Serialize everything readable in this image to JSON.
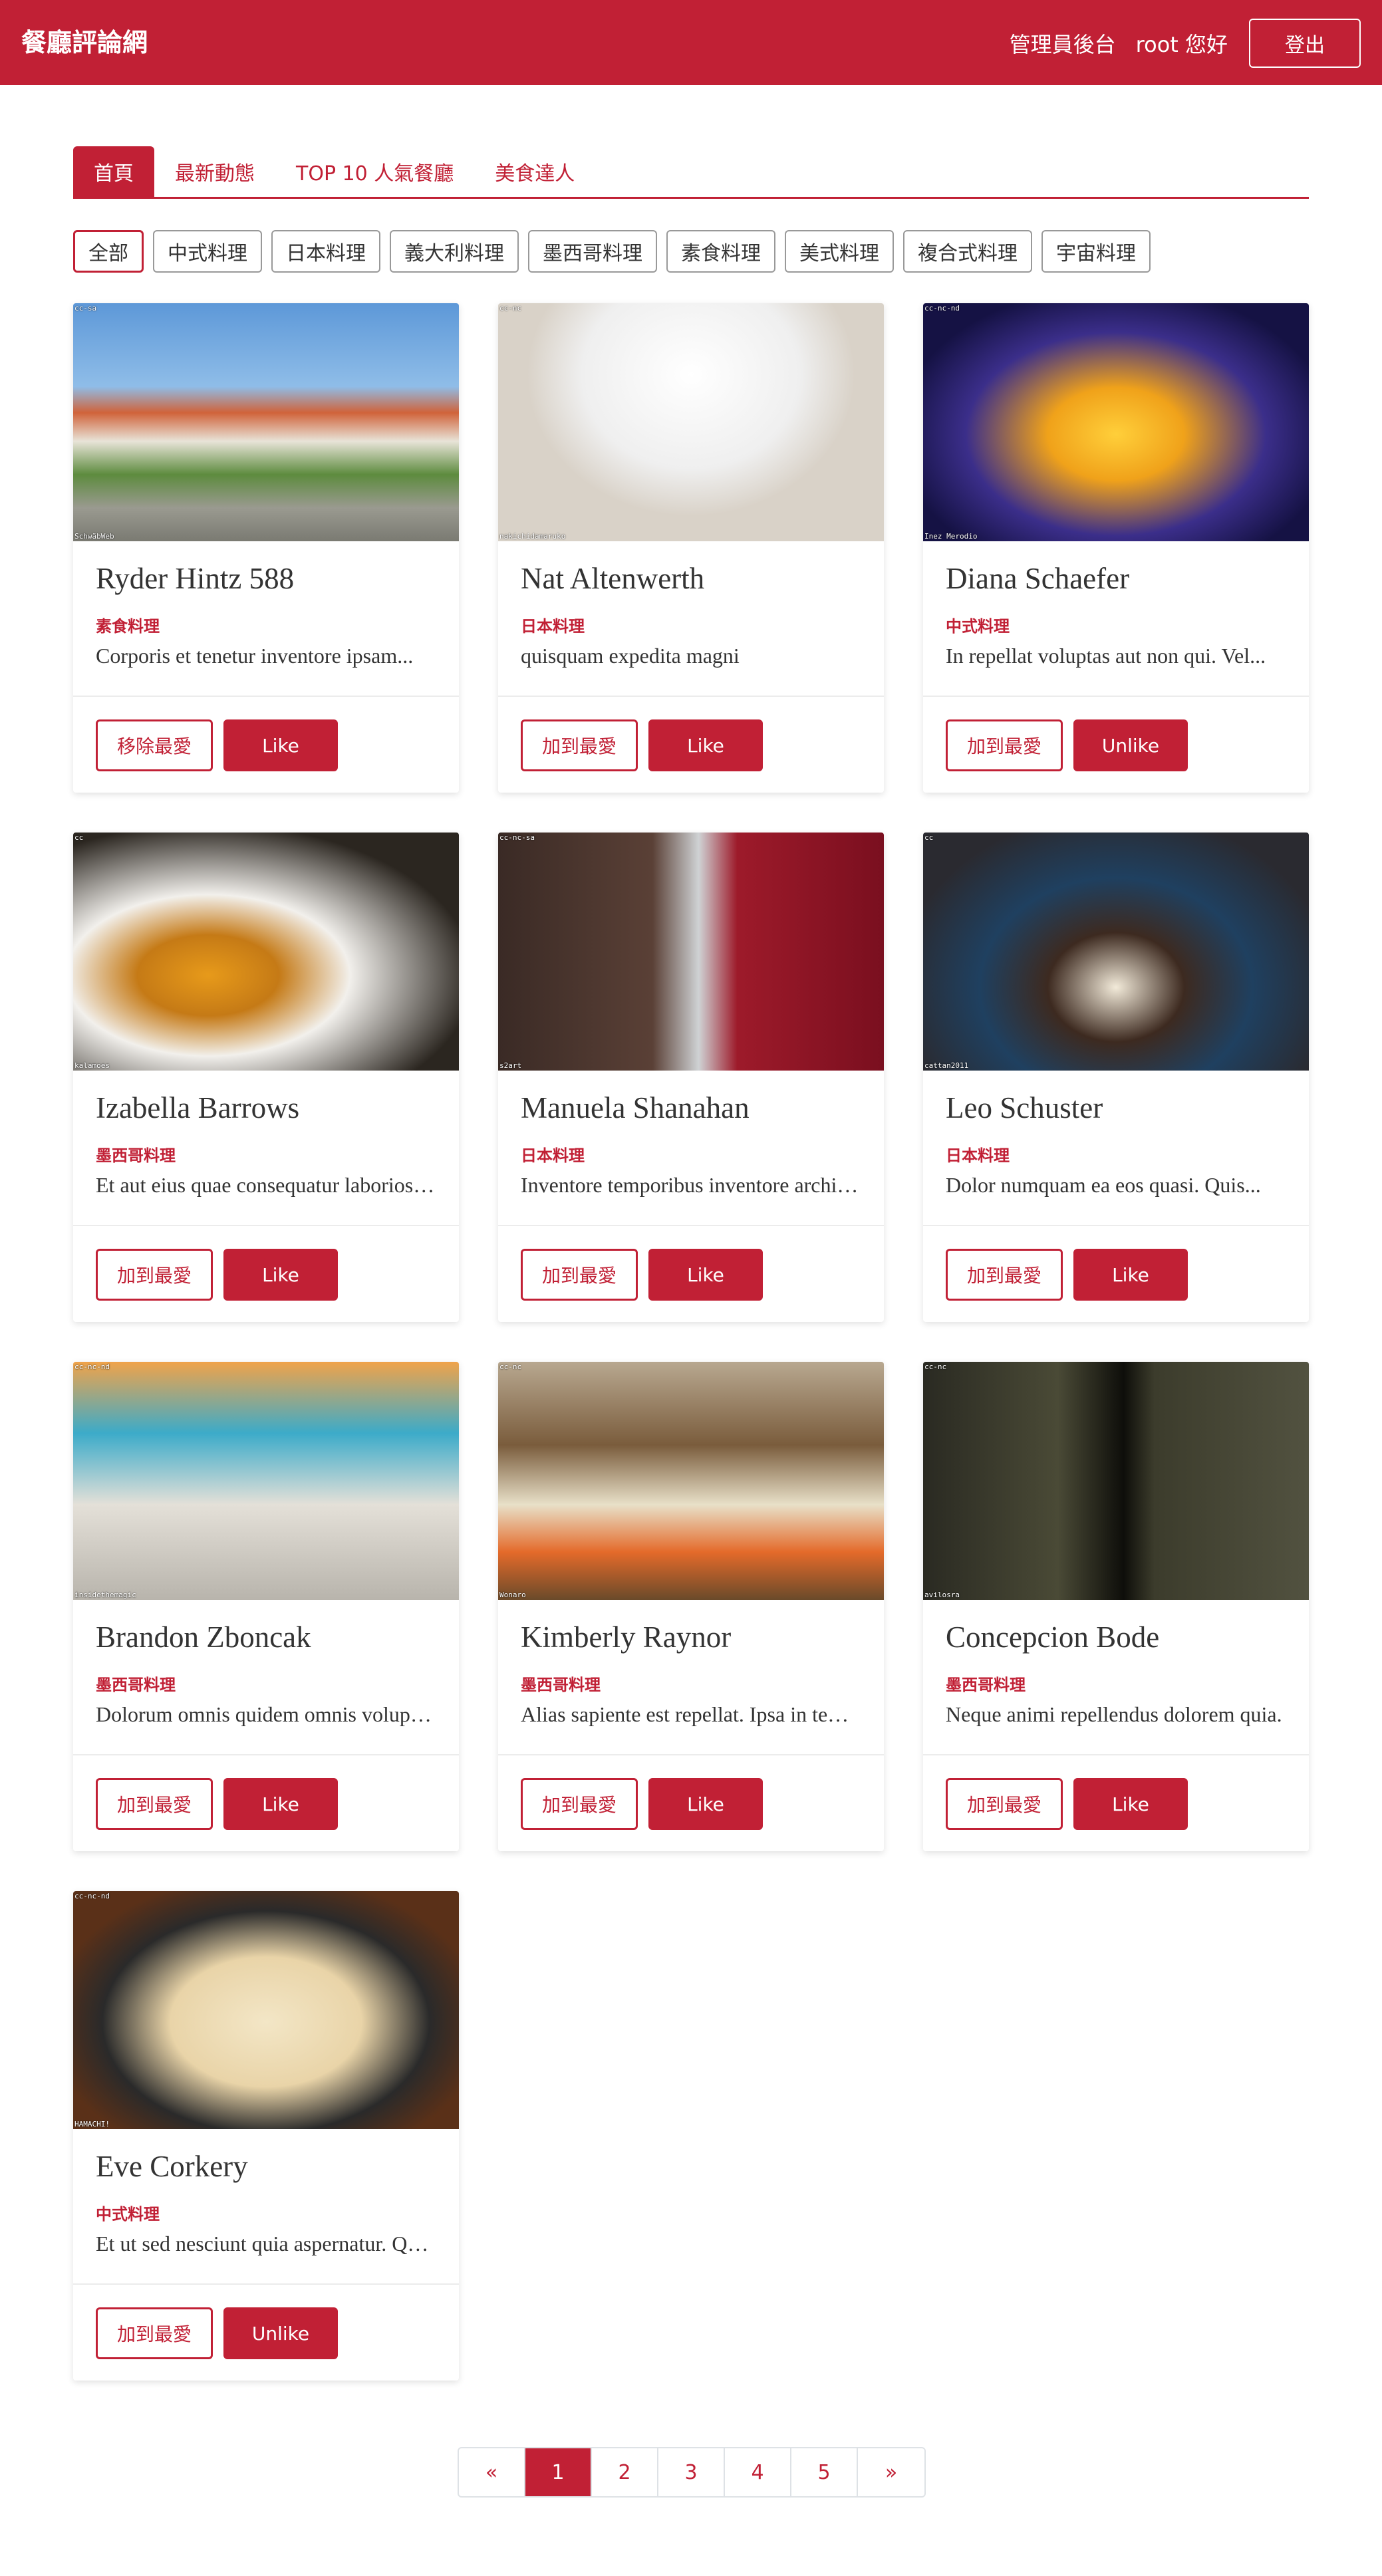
{
  "header": {
    "brand": "餐廳評論網",
    "admin_link": "管理員後台",
    "greeting": "root 您好",
    "logout_label": "登出"
  },
  "tabs": [
    {
      "label": "首頁",
      "active": true
    },
    {
      "label": "最新動態",
      "active": false
    },
    {
      "label": "TOP 10 人氣餐廳",
      "active": false
    },
    {
      "label": "美食達人",
      "active": false
    }
  ],
  "categories": [
    {
      "label": "全部",
      "active": true
    },
    {
      "label": "中式料理",
      "active": false
    },
    {
      "label": "日本料理",
      "active": false
    },
    {
      "label": "義大利料理",
      "active": false
    },
    {
      "label": "墨西哥料理",
      "active": false
    },
    {
      "label": "素食料理",
      "active": false
    },
    {
      "label": "美式料理",
      "active": false
    },
    {
      "label": "複合式料理",
      "active": false
    },
    {
      "label": "宇宙料理",
      "active": false
    }
  ],
  "restaurants": [
    {
      "name": "Ryder Hintz 588",
      "category": "素食料理",
      "description": "Corporis et tenetur inventore ipsam...",
      "favorite_label": "移除最愛",
      "like_label": "Like",
      "image_tag": "cc-sa",
      "image_credit": "SchwäbWeb",
      "image_theme": "house"
    },
    {
      "name": "Nat Altenwerth",
      "category": "日本料理",
      "description": "quisquam expedita magni",
      "favorite_label": "加到最愛",
      "like_label": "Like",
      "image_tag": "cc-nc",
      "image_credit": "nakichidamaruko",
      "image_theme": "dessert"
    },
    {
      "name": "Diana Schaefer",
      "category": "中式料理",
      "description": "In repellat voluptas aut non qui. Vel...",
      "favorite_label": "加到最愛",
      "like_label": "Unlike",
      "image_tag": "cc-nc-nd",
      "image_credit": "Inez Merodio",
      "image_theme": "flambe"
    },
    {
      "name": "Izabella Barrows",
      "category": "墨西哥料理",
      "description": "Et aut eius quae consequatur laboriosam.",
      "favorite_label": "加到最愛",
      "like_label": "Like",
      "image_tag": "cc",
      "image_credit": "kalamoes",
      "image_theme": "plated"
    },
    {
      "name": "Manuela Shanahan",
      "category": "日本料理",
      "description": "Inventore temporibus inventore architecto.",
      "favorite_label": "加到最愛",
      "like_label": "Like",
      "image_tag": "cc-nc-sa",
      "image_credit": "s2art",
      "image_theme": "interior"
    },
    {
      "name": "Leo Schuster",
      "category": "日本料理",
      "description": "Dolor numquam ea eos quasi. Quis...",
      "favorite_label": "加到最愛",
      "like_label": "Like",
      "image_tag": "cc",
      "image_credit": "cattan2011",
      "image_theme": "cake"
    },
    {
      "name": "Brandon Zboncak",
      "category": "墨西哥料理",
      "description": "Dolorum omnis quidem omnis voluptas.",
      "favorite_label": "加到最愛",
      "like_label": "Like",
      "image_tag": "cc-nc-nd",
      "image_credit": "insidethemagic",
      "image_theme": "mural"
    },
    {
      "name": "Kimberly Raynor",
      "category": "墨西哥料理",
      "description": "Alias sapiente est repellat. Ipsa in tempora.",
      "favorite_label": "加到最愛",
      "like_label": "Like",
      "image_tag": "cc-nc",
      "image_credit": "Wonaro",
      "image_theme": "market"
    },
    {
      "name": "Concepcion Bode",
      "category": "墨西哥料理",
      "description": "Neque animi repellendus dolorem quia.",
      "favorite_label": "加到最愛",
      "like_label": "Like",
      "image_tag": "cc-nc",
      "image_credit": "avilosra",
      "image_theme": "dark"
    },
    {
      "name": "Eve Corkery",
      "category": "中式料理",
      "description": "Et ut sed nesciunt quia aspernatur. Quo...",
      "favorite_label": "加到最愛",
      "like_label": "Unlike",
      "image_tag": "cc-nc-nd",
      "image_credit": "HAMACHI!",
      "image_theme": "noodles"
    }
  ],
  "pagination": {
    "prev": "«",
    "pages": [
      "1",
      "2",
      "3",
      "4",
      "5"
    ],
    "current": "1",
    "next": "»"
  }
}
